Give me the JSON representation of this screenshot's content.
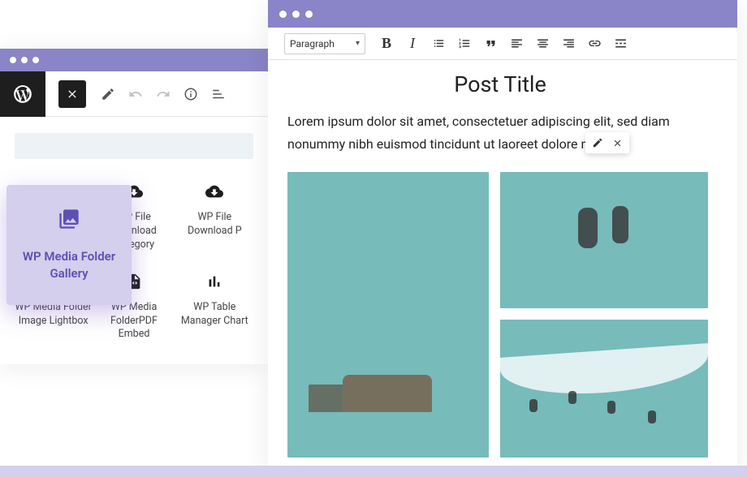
{
  "featured": {
    "label": "WP Media Folder Gallery"
  },
  "blocks": {
    "r1c2": "WP File Download Category",
    "r1c3": "WP File Download P",
    "r2c1": "WP Media Folder Image Lightbox",
    "r2c2": "WP Media FolderPDF Embed",
    "r2c3": "WP Table Manager Chart"
  },
  "editor": {
    "paragraph_label": "Paragraph",
    "title": "Post Title",
    "body": "Lorem ipsum dolor sit amet, consectetuer adipiscing elit, sed diam nonummy nibh euismod tincidunt ut laoreet dolore magna"
  }
}
